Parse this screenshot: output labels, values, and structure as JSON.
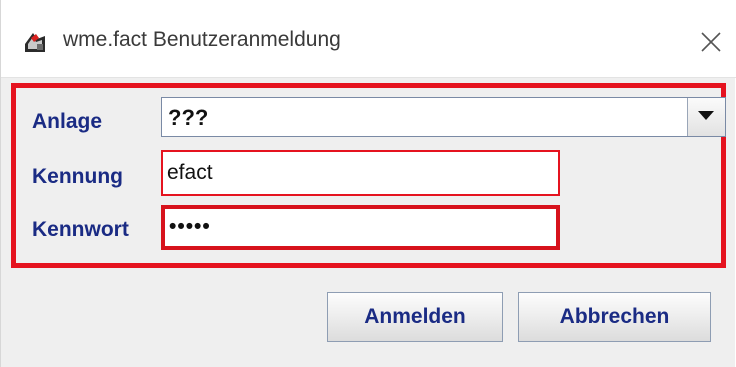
{
  "window": {
    "title": "wme.fact Benutzeranmeldung",
    "app_icon": "wme-fact-app-icon",
    "close_icon": "close-icon"
  },
  "form": {
    "anlage_label": "Anlage",
    "anlage_value": "???",
    "anlage_dropdown_icon": "chevron-down-icon",
    "kennung_label": "Kennung",
    "kennung_value": "efact",
    "kennwort_label": "Kennwort",
    "kennwort_value": "•••••"
  },
  "buttons": {
    "anmelden_label": "Anmelden",
    "abbrechen_label": "Abbrechen"
  },
  "colors": {
    "highlight_border": "#e5131f",
    "label_text": "#1a2b84",
    "dialog_background": "#efefef"
  }
}
